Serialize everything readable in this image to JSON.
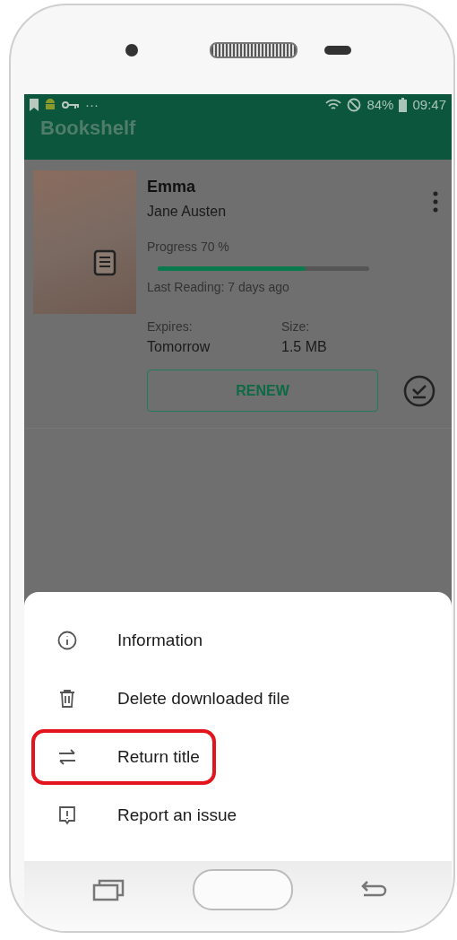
{
  "status_bar": {
    "overflow": "···",
    "battery": "84%",
    "time": "09:47"
  },
  "app_bar": {
    "title": "Bookshelf"
  },
  "book": {
    "title": "Emma",
    "author": "Jane Austen",
    "progress_label": "Progress 70 %",
    "level": 0.7,
    "last_reading": "Last Reading: 7 days ago",
    "expires_label": "Expires:",
    "expires_value": "Tomorrow",
    "size_label": "Size:",
    "size_value": "1.5 MB",
    "renew_button": "RENEW"
  },
  "menu": {
    "items": [
      {
        "label": "Information",
        "highlighted": false
      },
      {
        "label": "Delete downloaded file",
        "highlighted": false
      },
      {
        "label": "Return title",
        "highlighted": true
      },
      {
        "label": "Report an issue",
        "highlighted": false
      }
    ]
  }
}
